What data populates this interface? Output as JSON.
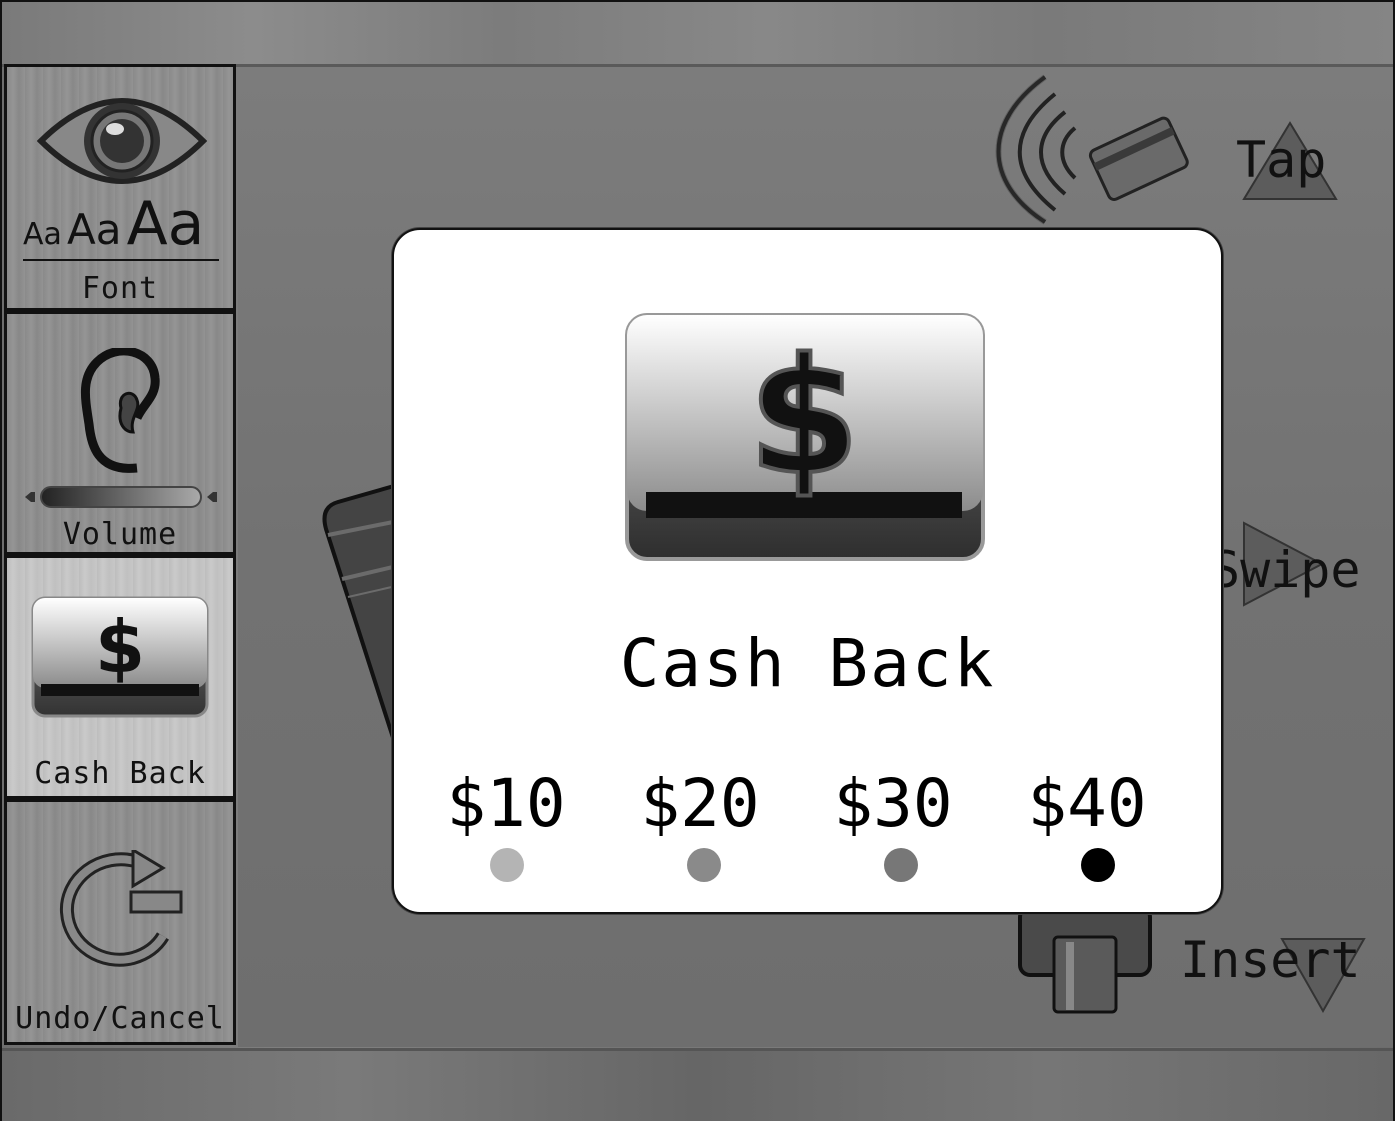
{
  "sidebar": {
    "items": [
      {
        "label": "Font",
        "icon": "eye-font-icon",
        "font_sample": [
          "Aa",
          "Aa",
          "Aa"
        ],
        "active": false
      },
      {
        "label": "Volume",
        "icon": "ear-icon",
        "active": false
      },
      {
        "label": "Cash Back",
        "icon": "cash-back-icon",
        "active": true
      },
      {
        "label": "Undo/Cancel",
        "icon": "undo-icon",
        "active": false
      }
    ]
  },
  "main": {
    "tap_label": "Tap",
    "swipe_label": "Swipe",
    "insert_label": "Insert"
  },
  "modal": {
    "title": "Cash Back",
    "icon": "cash-back-icon",
    "amounts": [
      {
        "label": "$10",
        "color": "#b4b4b4"
      },
      {
        "label": "$20",
        "color": "#8a8a8a"
      },
      {
        "label": "$30",
        "color": "#777777"
      },
      {
        "label": "$40",
        "color": "#000000"
      }
    ]
  }
}
